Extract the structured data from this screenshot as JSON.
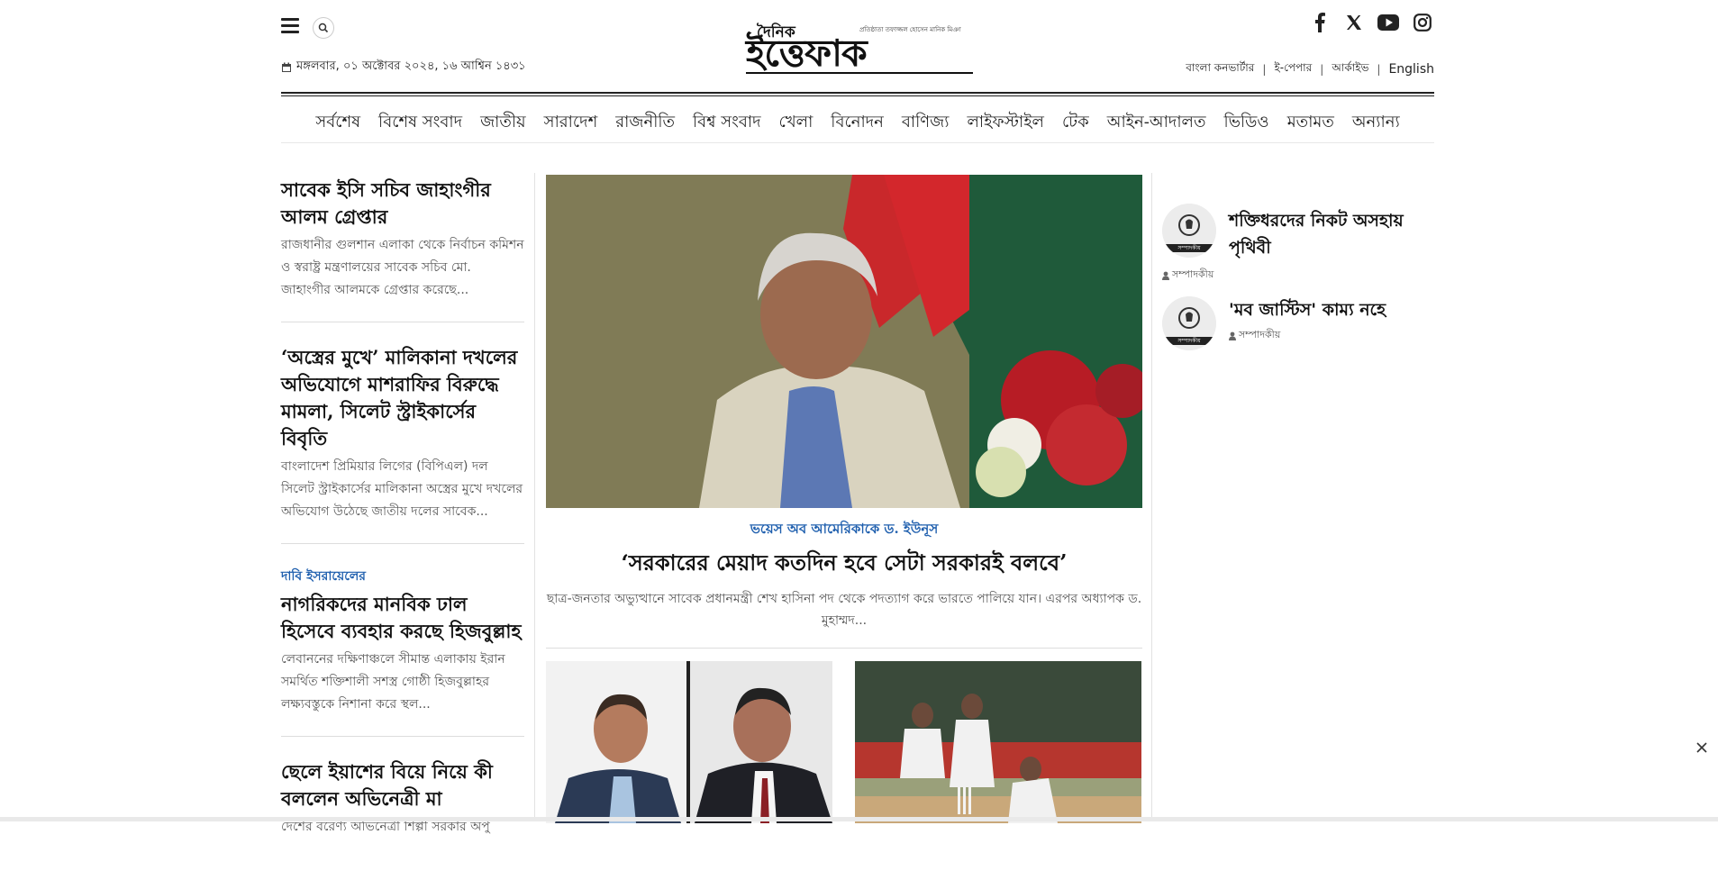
{
  "header": {
    "date": "মঙ্গলবার, ০১ অক্টোবর ২০২৪, ১৬ আশ্বিন ১৪৩১",
    "logo_small": "দৈনিক",
    "logo_main": "ইত্তেফাক",
    "logo_tagline": "প্রতিষ্ঠাতা তফাজ্জল হোসেন মানিক মিঞা",
    "links": [
      "বাংলা কনভার্টার",
      "ই-পেপার",
      "আর্কাইভ",
      "English"
    ],
    "social": [
      "facebook-icon",
      "x-icon",
      "youtube-icon",
      "instagram-icon"
    ]
  },
  "nav": [
    "সর্বশেষ",
    "বিশেষ সংবাদ",
    "জাতীয়",
    "সারাদেশ",
    "রাজনীতি",
    "বিশ্ব সংবাদ",
    "খেলা",
    "বিনোদন",
    "বাণিজ্য",
    "লাইফস্টাইল",
    "টেক",
    "আইন-আদালত",
    "ভিডিও",
    "মতামত",
    "অন্যান্য"
  ],
  "left_stories": [
    {
      "kicker": "",
      "title": "সাবেক ইসি সচিব জাহাংগীর আলম গ্রেপ্তার",
      "summary": "রাজধানীর গুলশান এলাকা থেকে নির্বাচন কমিশন ও স্বরাষ্ট্র মন্ত্রণালয়ের সাবেক সচিব মো. জাহাংগীর আলমকে গ্রেপ্তার করেছে..."
    },
    {
      "kicker": "",
      "title": "‘অস্ত্রের মুখে’ মালিকানা দখলের অভিযোগে মাশরাফির বিরুদ্ধে মামলা, সিলেট স্ট্রাইকার্সের বিবৃতি",
      "summary": "বাংলাদেশ প্রিমিয়ার লিগের (বিপিএল) দল সিলেট স্ট্রাইকার্সের মালিকানা অস্ত্রের মুখে দখলের অভিযোগ উঠেছে জাতীয় দলের সাবেক..."
    },
    {
      "kicker": "দাবি ইসরায়েলের",
      "title": "নাগরিকদের মানবিক ঢাল হিসেবে ব্যবহার করছে হিজবুল্লাহ",
      "summary": "লেবাননের দক্ষিণাঞ্চলে সীমান্ত এলাকায় ইরান সমর্থিত শক্তিশালী সশস্ত্র গোষ্ঠী হিজবুল্লাহর লক্ষ্যবস্তুকে নিশানা করে স্থল..."
    },
    {
      "kicker": "",
      "title": "ছেলে ইয়াশের বিয়ে নিয়ে কী বললেন অভিনেত্রী মা",
      "summary": "দেশের বরেণ্য অভিনেত্রী শিল্পী সরকার অপু"
    }
  ],
  "lead": {
    "kicker": "ভয়েস অব আমেরিকাকে ড. ইউনূস",
    "title": "‘সরকারের মেয়াদ কতদিন হবে সেটা সরকারই বলবে’",
    "summary": "ছাত্র-জনতার অভ্যুত্থানে সাবেক প্রধানমন্ত্রী শেখ হাসিনা পদ থেকে পদত্যাগ করে ভারতে পালিয়ে যান। এরপর অধ্যাপক ড. মুহাম্মদ..."
  },
  "opinion": [
    {
      "title": "শক্তিধরদের নিকট অসহায় পৃথিবী",
      "byline": "সম্পাদকীয়",
      "badge": "সম্পাদকীয়"
    },
    {
      "title": "'মব জাস্টিস' কাম্য নহে",
      "byline": "সম্পাদকীয়",
      "badge": "সম্পাদকীয়"
    }
  ],
  "colors": {
    "accent": "#1f5fae",
    "text": "#111111"
  }
}
